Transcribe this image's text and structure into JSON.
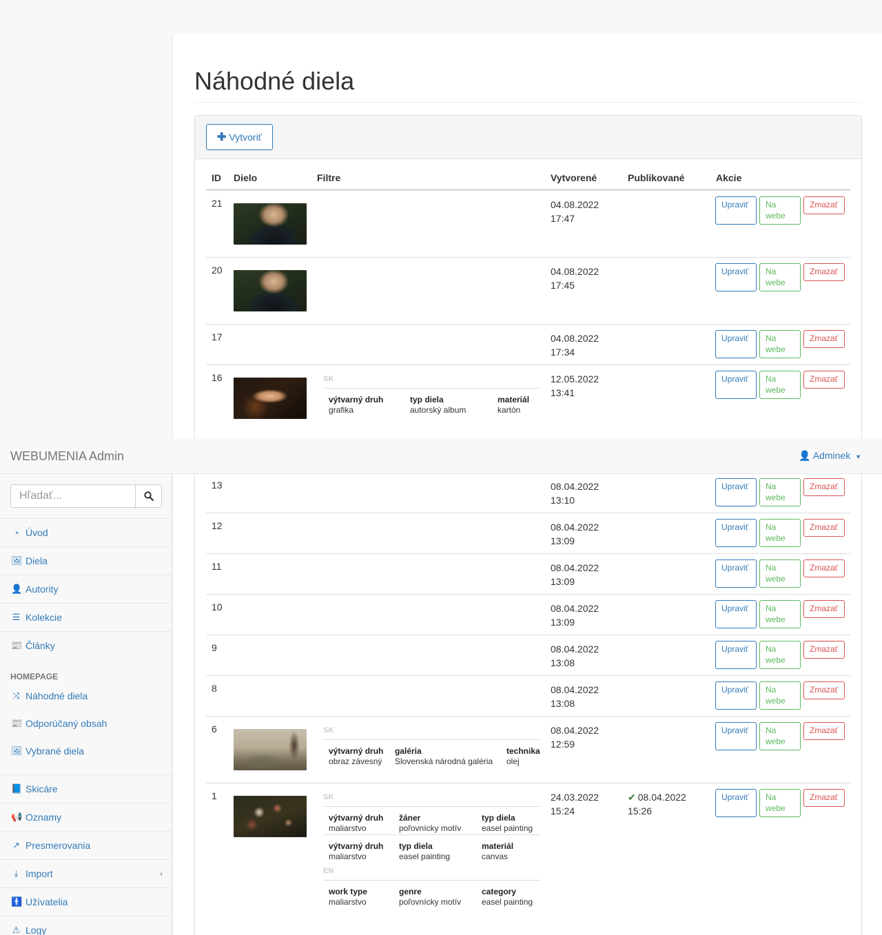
{
  "app": {
    "brand": "WEBUMENIA Admin",
    "user": "Adminek"
  },
  "page": {
    "title": "Náhodné diela",
    "create_label": "Vytvoriť"
  },
  "table": {
    "headers": {
      "id": "ID",
      "work": "Dielo",
      "filters": "Filtre",
      "created": "Vytvorené",
      "published": "Publikované",
      "actions": "Akcie"
    },
    "actions": {
      "edit": "Upraviť",
      "web_line1": "Na",
      "web_line2": "webe",
      "delete": "Zmazať"
    },
    "rows": [
      {
        "id": "21",
        "date": "04.08.2022",
        "time": "17:47"
      },
      {
        "id": "20",
        "date": "04.08.2022",
        "time": "17:45"
      },
      {
        "id": "17",
        "date": "04.08.2022",
        "time": "17:34"
      },
      {
        "id": "16",
        "date": "12.05.2022",
        "time": "13:41",
        "lang": "SK",
        "filters": [
          {
            "label": "výtvarný druh",
            "value": "grafika"
          },
          {
            "label": "typ diela",
            "value": "autorský album"
          },
          {
            "label": "materiál",
            "value": "kartón"
          }
        ]
      },
      {
        "id": "13",
        "date": "08.04.2022",
        "time": "13:10"
      },
      {
        "id": "12",
        "date": "08.04.2022",
        "time": "13:09"
      },
      {
        "id": "11",
        "date": "08.04.2022",
        "time": "13:09"
      },
      {
        "id": "10",
        "date": "08.04.2022",
        "time": "13:09"
      },
      {
        "id": "9",
        "date": "08.04.2022",
        "time": "13:08"
      },
      {
        "id": "8",
        "date": "08.04.2022",
        "time": "13:08"
      },
      {
        "id": "6",
        "date": "08.04.2022",
        "time": "12:59",
        "lang": "SK",
        "filters": [
          {
            "label": "výtvarný druh",
            "value": "obraz závesný"
          },
          {
            "label": "galéria",
            "value": "Slovenská národná galéria"
          },
          {
            "label": "technika",
            "value": "olej"
          }
        ]
      },
      {
        "id": "1",
        "date": "24.03.2022",
        "time": "15:24",
        "pub_date": "08.04.2022",
        "pub_time": "15:26",
        "lang": "SK",
        "lang2": "EN",
        "filters": [
          {
            "label": "výtvarný druh",
            "value": "maliarstvo"
          },
          {
            "label": "žáner",
            "value": "poľovnícky motív"
          },
          {
            "label": "typ diela",
            "value": "easel painting"
          }
        ],
        "filters2": [
          {
            "label": "výtvarný druh",
            "value": "maliarstvo"
          },
          {
            "label": "typ diela",
            "value": "easel painting"
          },
          {
            "label": "materiál",
            "value": "canvas"
          }
        ],
        "filters3": [
          {
            "label": "work type",
            "value": "maliarstvo"
          },
          {
            "label": "genre",
            "value": "poľovnícky motív"
          },
          {
            "label": "category",
            "value": "easel painting"
          }
        ]
      }
    ]
  },
  "sidebar": {
    "search_placeholder": "Hľadať...",
    "items": [
      {
        "label": "Úvod",
        "icon": "dashboard-icon"
      },
      {
        "label": "Diela",
        "icon": "image-icon"
      },
      {
        "label": "Autority",
        "icon": "user-icon"
      },
      {
        "label": "Kolekcie",
        "icon": "list-icon"
      },
      {
        "label": "Články",
        "icon": "newspaper-icon"
      }
    ],
    "section_homepage": "HOMEPAGE",
    "homepage_items": [
      {
        "label": "Náhodné diela",
        "icon": "random-icon"
      },
      {
        "label": "Odporúčaný obsah",
        "icon": "newspaper-icon"
      },
      {
        "label": "Vybrané diela",
        "icon": "image-icon"
      }
    ],
    "items2": [
      {
        "label": "Skicáre",
        "icon": "book-icon"
      },
      {
        "label": "Oznamy",
        "icon": "bullhorn-icon"
      },
      {
        "label": "Presmerovania",
        "icon": "external-link-icon"
      },
      {
        "label": "Import",
        "icon": "download-icon"
      },
      {
        "label": "Užívatelia",
        "icon": "male-icon"
      },
      {
        "label": "Logy",
        "icon": "warning-icon"
      }
    ]
  }
}
